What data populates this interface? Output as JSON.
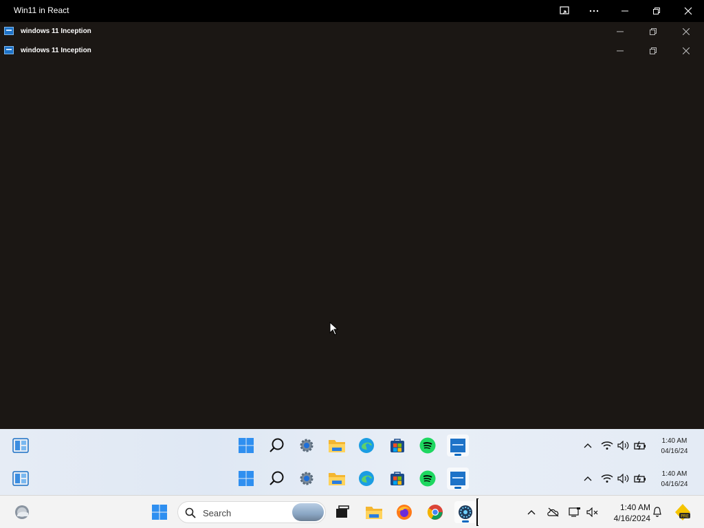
{
  "window": {
    "title": "Win11 in React"
  },
  "inner_windows": [
    {
      "label": "windows 11 Inception"
    },
    {
      "label": "windows 11 Inception"
    }
  ],
  "inner_taskbars": [
    {
      "time": "1:40 AM",
      "date": "04/16/24"
    },
    {
      "time": "1:40 AM",
      "date": "04/16/24"
    }
  ],
  "taskbar_icons": [
    "widgets-icon",
    "start-icon",
    "search-icon",
    "settings-icon",
    "file-explorer-icon",
    "edge-icon",
    "store-icon",
    "spotify-icon",
    "windows11-app-icon"
  ],
  "real_taskbar": {
    "search_placeholder": "Search",
    "time": "1:40 AM",
    "date": "4/16/2024",
    "app_icons": [
      "weather-icon",
      "start-icon",
      "search-icon",
      "task-view-icon",
      "file-explorer-icon",
      "firefox-icon",
      "chrome-icon",
      "vscode-icon"
    ]
  },
  "colors": {
    "desktop": "#1b1714",
    "titlebar": "#000000",
    "accent": "#0067c0"
  }
}
